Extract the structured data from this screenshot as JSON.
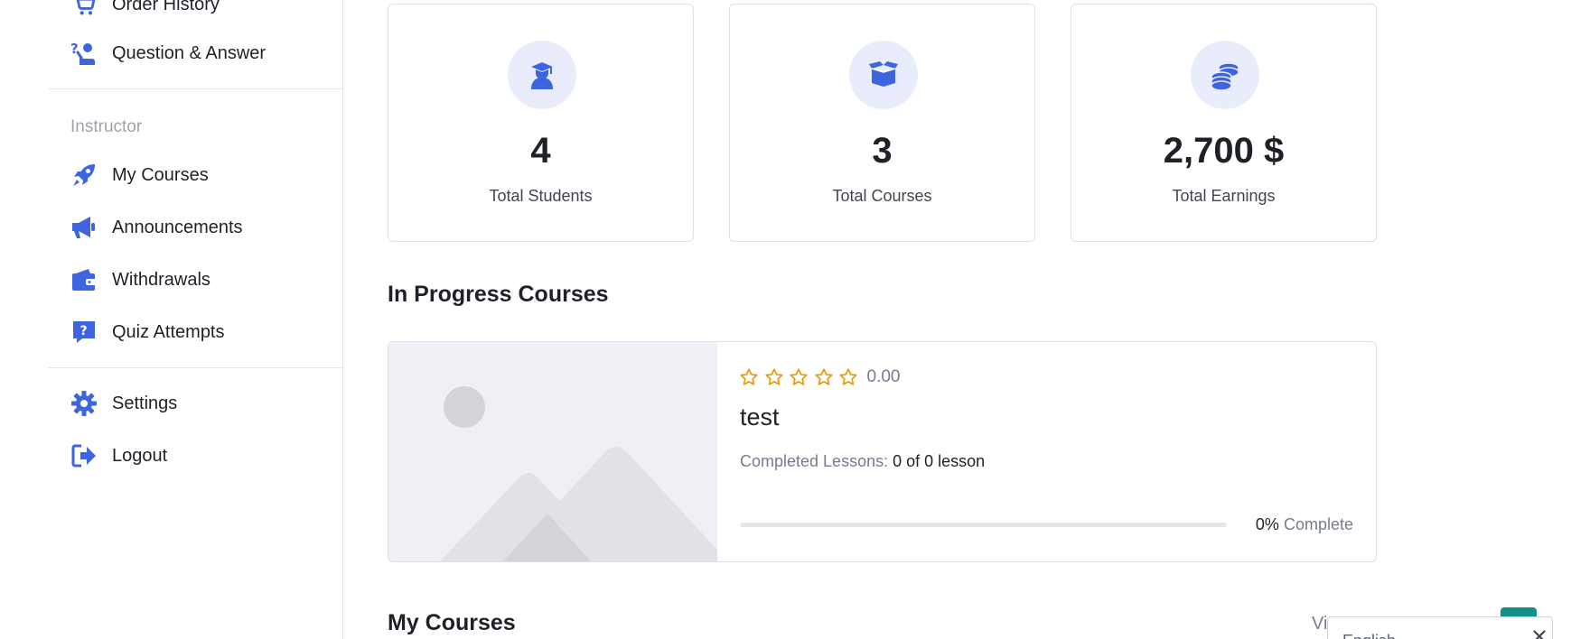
{
  "sidebar": {
    "items_top": [
      {
        "label": "Order History",
        "icon": "cart-icon"
      },
      {
        "label": "Question & Answer",
        "icon": "question-answer-icon"
      }
    ],
    "instructor_title": "Instructor",
    "instructor_items": [
      {
        "label": "My Courses",
        "icon": "rocket-icon"
      },
      {
        "label": "Announcements",
        "icon": "megaphone-icon"
      },
      {
        "label": "Withdrawals",
        "icon": "wallet-icon"
      },
      {
        "label": "Quiz Attempts",
        "icon": "quiz-icon"
      }
    ],
    "bottom_items": [
      {
        "label": "Settings",
        "icon": "gear-icon"
      },
      {
        "label": "Logout",
        "icon": "logout-icon"
      }
    ]
  },
  "stats": [
    {
      "value": "4",
      "label": "Total Students",
      "icon": "graduate-icon"
    },
    {
      "value": "3",
      "label": "Total Courses",
      "icon": "open-box-icon"
    },
    {
      "value": "2,700 $",
      "label": "Total Earnings",
      "icon": "coins-icon"
    }
  ],
  "in_progress": {
    "heading": "In Progress Courses",
    "course": {
      "rating": "0.00",
      "rating_stars": 0,
      "title": "test",
      "lessons_label": "Completed Lessons:",
      "lessons_value": "0 of 0 lesson",
      "progress": 0,
      "progress_percent": "0%",
      "progress_suffix": "Complete"
    }
  },
  "my_courses": {
    "heading": "My Courses",
    "view_all": "Vi"
  },
  "language": {
    "selected": "English"
  },
  "colors": {
    "accent": "#3e64de",
    "star": "#ed9700",
    "teal": "#14908a"
  }
}
